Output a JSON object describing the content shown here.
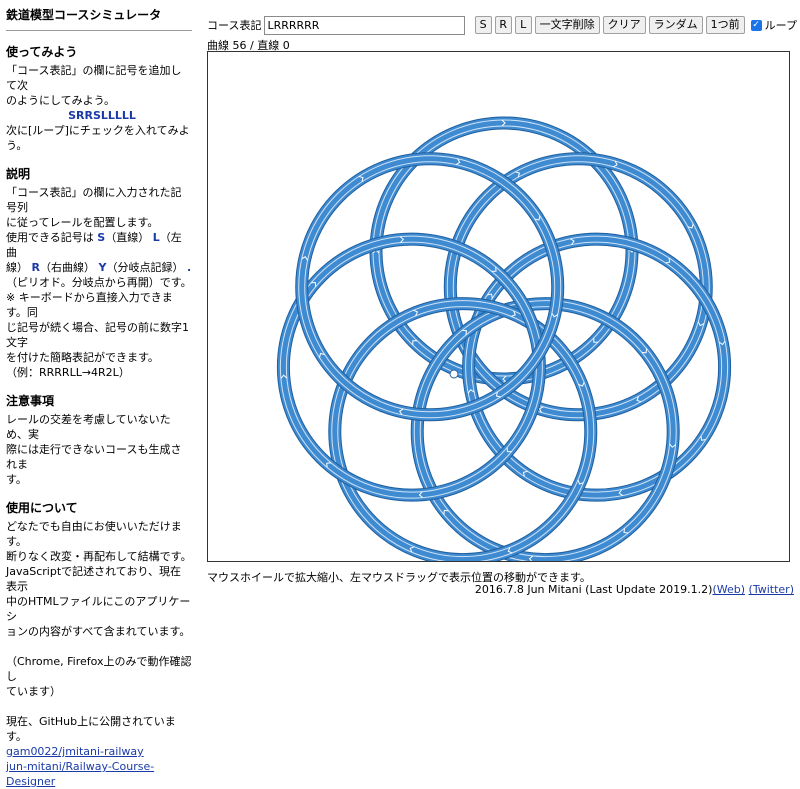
{
  "sidebar": {
    "title": "鉄道模型コースシミュレータ",
    "try_heading": "使ってみよう",
    "try_line1": "「コース表記」の欄に記号を追加して次",
    "try_line2": "のようにしてみよう。",
    "try_example": "SRRSLLLLL",
    "try_line3": "次に[ループ]にチェックを入れてみよう。",
    "desc_heading": "説明",
    "desc_line1": "「コース表記」の欄に入力された記号列",
    "desc_line2": "に従ってレールを配置します。",
    "desc_line3_prefix": "使用できる記号は",
    "desc_s": "S",
    "desc_s_text": "（直線）",
    "desc_l": "L",
    "desc_l_text": "（左曲",
    "desc_line4_prefix": "線）",
    "desc_r": "R",
    "desc_r_text": "（右曲線）",
    "desc_y": "Y",
    "desc_y_text": "（分岐点記録）",
    "desc_dot": ".",
    "desc_line5": "（ピリオド。分岐点から再開）です。",
    "desc_line6": "※ キーボードから直接入力できます。同",
    "desc_line7": "じ記号が続く場合、記号の前に数字1文字",
    "desc_line8": "を付けた簡略表記ができます。",
    "desc_line9": "（例：RRRRLL→4R2L）",
    "note_heading": "注意事項",
    "note_line1": "レールの交差を考慮していないため、実",
    "note_line2": "際には走行できないコースも生成されま",
    "note_line3": "す。",
    "use_heading": "使用について",
    "use_line1": "どなたでも自由にお使いいただけます。",
    "use_line2": "断りなく改変・再配布して結構です。",
    "use_line3": "JavaScriptで記述されており、現在表示",
    "use_line4": "中のHTMLファイルにこのアプリケーシ",
    "use_line5": "ョンの内容がすべて含まれています。",
    "use_line6": "（Chrome, Firefox上のみで動作確認し",
    "use_line7": "ています）",
    "github_line": "現在、GitHub上に公開されています。",
    "github_link1": "gam0022/jmitani-railway",
    "github_link2": "jun-mitani/Railway-Course-Designer"
  },
  "toolbar": {
    "course_label": "コース表記",
    "course_value": "LRRRRRR",
    "btn_s": "S",
    "btn_r": "R",
    "btn_l": "L",
    "btn_delete": "一文字削除",
    "btn_clear": "クリア",
    "btn_random": "ランダム",
    "btn_back": "1つ前",
    "loop_label": "ループ",
    "loop_checked": true
  },
  "status": {
    "counter": "曲線 56 / 直線 0"
  },
  "canvas": {
    "rail_color": "#3f8bd2",
    "rail_edge_color": "#1f5f9e",
    "rail_light_color": "#cfe2f5",
    "marker_color": "#ffffff"
  },
  "hint": "マウスホイールで拡大縮小、左マウスドラッグで表示位置の移動ができます。",
  "footer": {
    "text": "2016.7.8 Jun Mitani (Last Update 2019.1.2)",
    "link_web": "(Web)",
    "link_twitter": "(Twitter)"
  }
}
